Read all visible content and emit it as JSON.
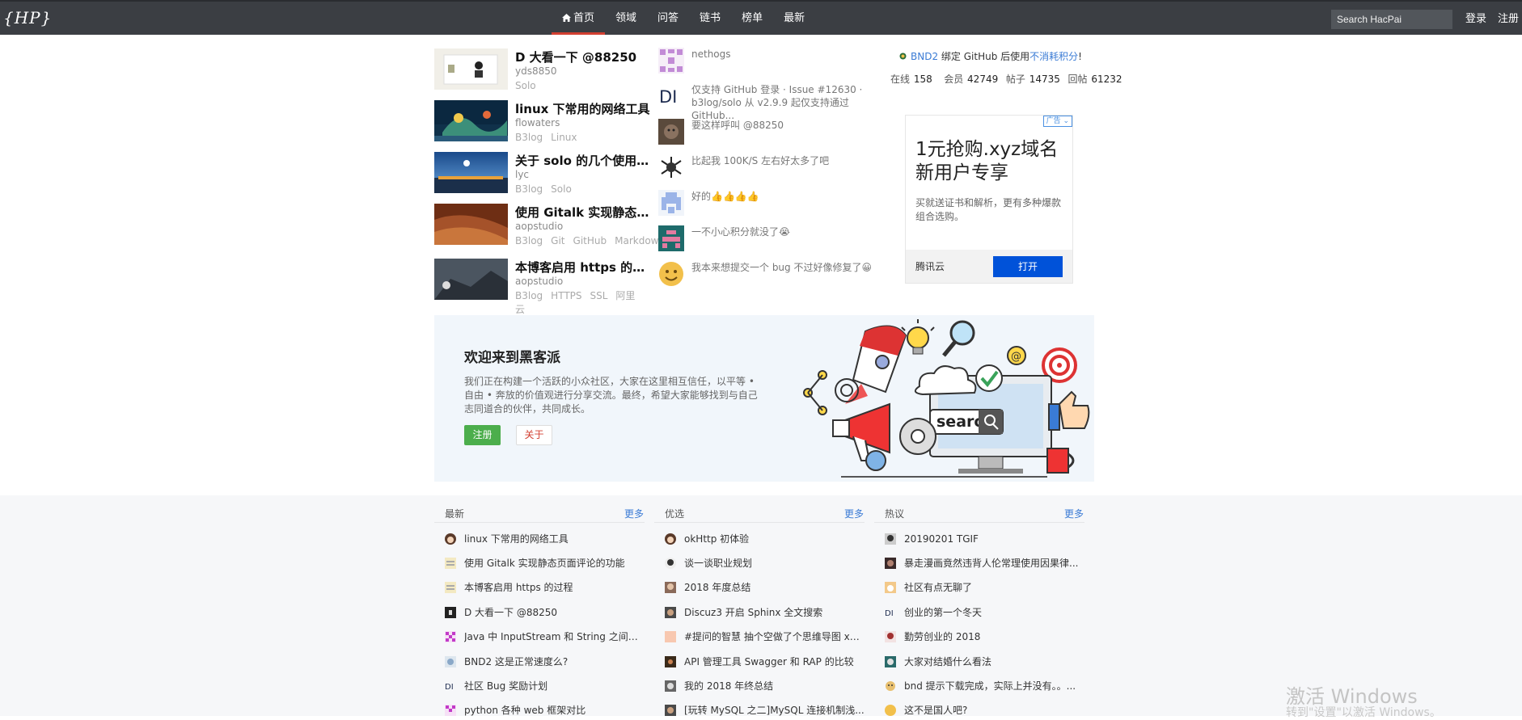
{
  "header": {
    "logo": "{HP}",
    "nav": [
      "首页",
      "领域",
      "问答",
      "链书",
      "榜单",
      "最新"
    ],
    "search_placeholder": "Search HacPai",
    "login": "登录",
    "register": "注册"
  },
  "featured": [
    {
      "title": "D 大看一下 @88250",
      "author": "yds8850",
      "tags": [
        "Solo"
      ]
    },
    {
      "title": "linux 下常用的网络工具",
      "author": "flowaters",
      "tags": [
        "B3log",
        "Linux"
      ]
    },
    {
      "title": "关于 solo 的几个使用问题",
      "author": "lyc",
      "tags": [
        "B3log",
        "Solo"
      ]
    },
    {
      "title": "使用 Gitalk 实现静态页面评论的功能",
      "author": "aopstudio",
      "tags": [
        "B3log",
        "Git",
        "GitHub",
        "Markdown"
      ]
    },
    {
      "title": "本博客启用 https 的过程",
      "author": "aopstudio",
      "tags": [
        "B3log",
        "HTTPS",
        "SSL",
        "阿里云"
      ]
    }
  ],
  "comments": [
    {
      "text": "nethogs"
    },
    {
      "text": "仅支持 GitHub 登录 · Issue #12630 · b3log/solo 从 v2.9.9 起仅支持通过 GitHub..."
    },
    {
      "text": "要这样呼叫 @88250"
    },
    {
      "text": "比起我 100K/S 左右好太多了吧"
    },
    {
      "text": "好的👍👍👍👍"
    },
    {
      "text": "一不小心积分就没了😭"
    },
    {
      "text": "我本来想提交一个 bug 不过好像修复了😀"
    }
  ],
  "stats": {
    "bnd_user": "BND2",
    "bnd_text": "绑定 GitHub 后使用",
    "bnd_link": "不消耗积分",
    "bnd_end": "!",
    "online_label": "在线",
    "online": "158",
    "members_label": "会员",
    "members": "42749",
    "posts_label": "帖子",
    "posts": "14735",
    "replies_label": "回帖",
    "replies": "61232"
  },
  "ad": {
    "tag": "广告",
    "headline": "1元抢购.xyz域名新用户专享",
    "desc": "买就送证书和解析，更有多种爆款组合选购。",
    "brand": "腾讯云",
    "button": "打开"
  },
  "welcome": {
    "title": "欢迎来到黑客派",
    "text": "我们正在构建一个活跃的小众社区，大家在这里相互信任，以平等 • 自由 • 奔放的价值观进行分享交流。最终，希望大家能够找到与自己志同道合的伙伴，共同成长。",
    "register": "注册",
    "about": "关于",
    "illustration_text": "search"
  },
  "lists": [
    {
      "title": "最新",
      "more": "更多",
      "items": [
        "linux 下常用的网络工具",
        "使用 Gitalk 实现静态页面评论的功能",
        "本博客启用 https 的过程",
        "D 大看一下 @88250",
        "Java 中 InputStream 和 String 之间的转...",
        "BND2 这是正常速度么?",
        "社区 Bug 奖励计划",
        "python 各种 web 框架对比"
      ]
    },
    {
      "title": "优选",
      "more": "更多",
      "items": [
        "okHttp 初体验",
        "谈一谈职业规划",
        "2018 年度总结",
        "Discuz3 开启 Sphinx 全文搜索",
        "#提问的智慧 抽个空做了个思维导图 xm...",
        "API 管理工具 Swagger 和 RAP 的比较",
        "我的 2018 年终总结",
        "[玩转 MySQL 之二]MySQL 连接机制浅..."
      ]
    },
    {
      "title": "热议",
      "more": "更多",
      "items": [
        "20190201 TGIF",
        "暴走漫画竟然违背人伦常理使用因果律...",
        "社区有点无聊了",
        "创业的第一个冬天",
        "勤劳创业的 2018",
        "大家对结婚什么看法",
        "bnd 提示下载完成，实际上并没有。。...",
        "这不是国人吧?"
      ]
    }
  ],
  "watermark": {
    "line1": "激活 Windows",
    "line2": "转到\"设置\"以激活 Windows。"
  }
}
